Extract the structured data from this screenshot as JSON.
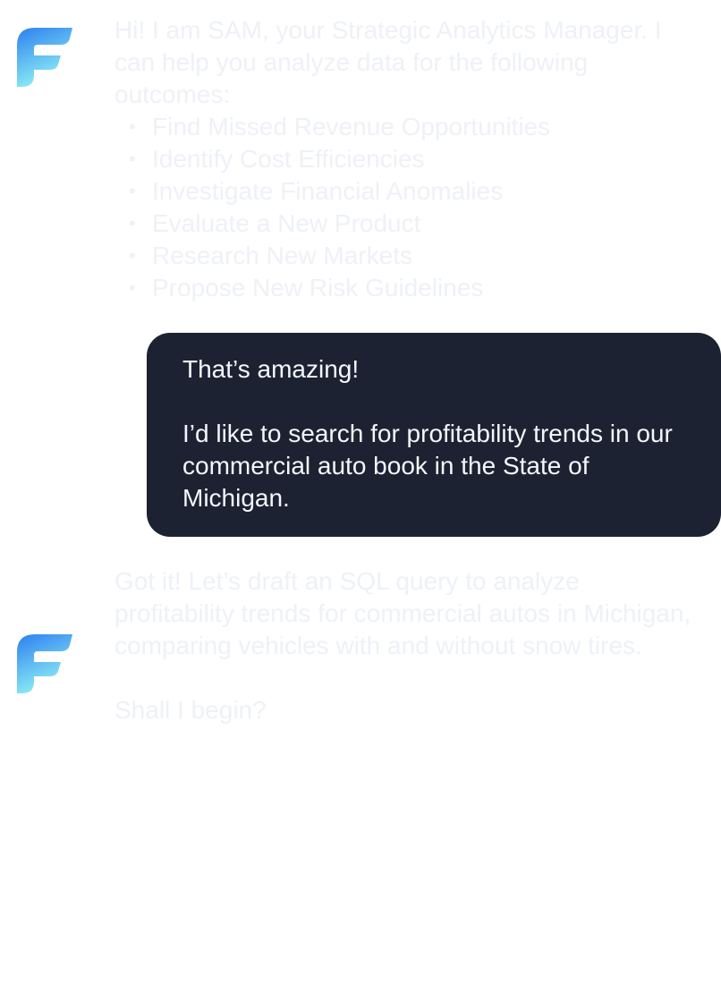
{
  "chat": {
    "assistant_intro": {
      "text": "Hi! I am SAM, your Strategic Analytics Manager. I can help you analyze data for the following outcomes:",
      "outcomes": [
        "Find Missed Revenue Opportunities",
        "Identify Cost Efficiencies",
        "Investigate Financial Anomalies",
        "Evaluate a New Product",
        "Research New Markets",
        "Propose New Risk Guidelines"
      ]
    },
    "user_message": {
      "line1": "That’s amazing!",
      "line2": "I’d like to search for profitability trends in our commercial auto book in the State of Michigan."
    },
    "assistant_reply": {
      "paragraph1": "Got it! Let’s draft an SQL query to analyze profitability trends for commercial autos in Michigan, comparing vehicles with and without snow tires.",
      "paragraph2": "Shall I begin?"
    }
  },
  "colors": {
    "assistant_text": "#eef1f6",
    "user_bubble_bg": "#1c2232",
    "user_text": "#f4f6fa",
    "logo_gradient_top": "#2c7ff0",
    "logo_gradient_bottom": "#8ff0f4"
  },
  "icons": {
    "assistant_avatar": "brand-f-logo-icon"
  }
}
